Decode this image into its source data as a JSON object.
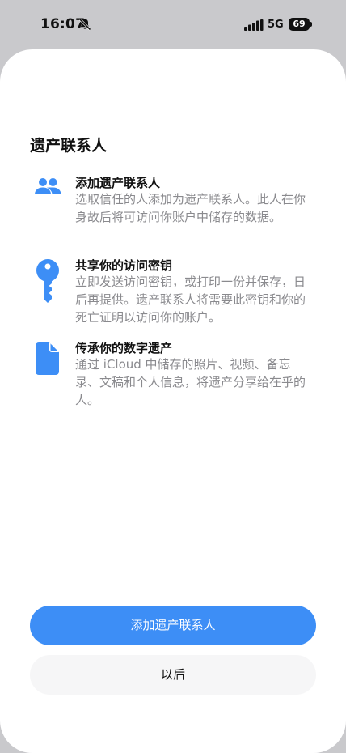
{
  "status_bar": {
    "time": "16:07",
    "network": "5G",
    "battery": "69",
    "icons": [
      "bell-slash-icon",
      "signal-icon",
      "battery-icon"
    ]
  },
  "sheet": {
    "title": "遗产联系人",
    "features": [
      {
        "icon": "people-icon",
        "heading": "添加遗产联系人",
        "description": "选取信任的人添加为遗产联系人。此人在你身故后将可访问你账户中储存的数据。"
      },
      {
        "icon": "key-icon",
        "heading": "共享你的访问密钥",
        "description": "立即发送访问密钥，或打印一份并保存，日后再提供。遗产联系人将需要此密钥和你的死亡证明以访问你的账户。"
      },
      {
        "icon": "document-icon",
        "heading": "传承你的数字遗产",
        "description": "通过 iCloud 中储存的照片、视频、备忘录、文稿和个人信息，将遗产分享给在乎的人。"
      }
    ],
    "primary_button": "添加遗产联系人",
    "secondary_button": "以后"
  },
  "colors": {
    "accent": "#3d8ef6",
    "secondary_text": "#8a8a8e",
    "sheet_bg": "#ffffff",
    "backdrop": "#c9c9cc"
  }
}
